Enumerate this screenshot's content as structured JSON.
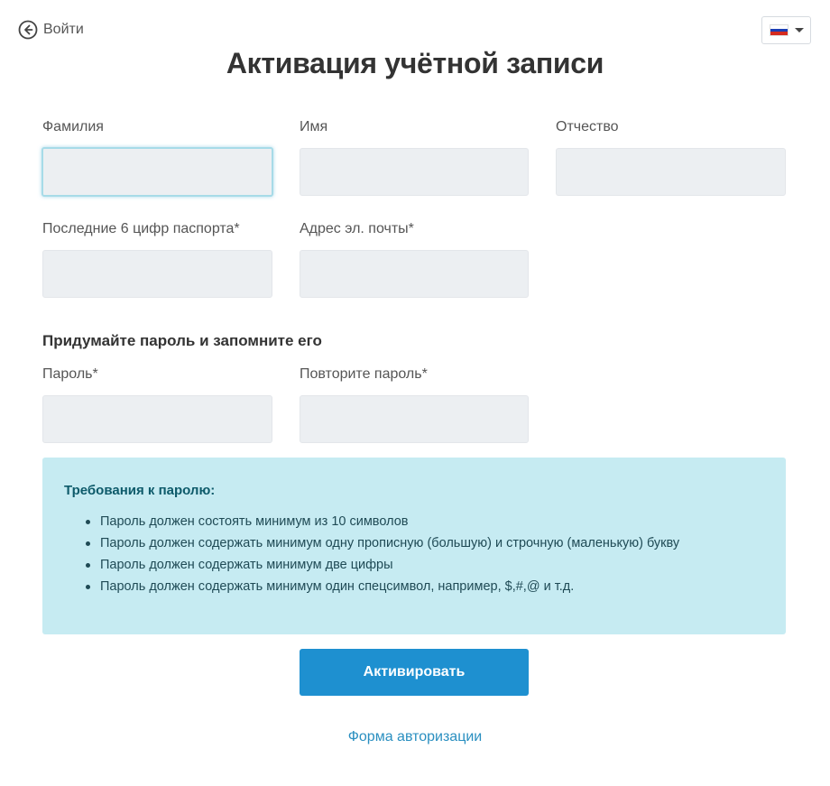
{
  "header": {
    "back_label": "Войти",
    "title": "Активация учётной записи",
    "language_flag_colors": [
      "#ffffff",
      "#1c3fb5",
      "#d52b1e"
    ]
  },
  "form": {
    "last_name": {
      "label": "Фамилия",
      "value": ""
    },
    "first_name": {
      "label": "Имя",
      "value": ""
    },
    "middle_name": {
      "label": "Отчество",
      "value": ""
    },
    "passport": {
      "label": "Последние 6 цифр паспорта*",
      "value": ""
    },
    "email": {
      "label": "Адрес эл. почты*",
      "value": ""
    },
    "password_section_title": "Придумайте пароль и запомните его",
    "password": {
      "label": "Пароль*",
      "value": ""
    },
    "password_repeat": {
      "label": "Повторите пароль*",
      "value": ""
    }
  },
  "requirements": {
    "title": "Требования к паролю:",
    "items": [
      "Пароль должен состоять минимум из 10 символов",
      "Пароль должен содержать минимум одну прописную (большую) и строчную (маленькую) букву",
      "Пароль должен содержать минимум две цифры",
      "Пароль должен содержать минимум один спецсимвол, например, $,#,@ и т.д."
    ]
  },
  "actions": {
    "submit_label": "Активировать",
    "login_form_link": "Форма авторизации"
  },
  "colors": {
    "accent": "#1e90d0",
    "input_bg": "#eceff2",
    "info_bg": "#c6ebf2",
    "link": "#2a8fc0"
  }
}
